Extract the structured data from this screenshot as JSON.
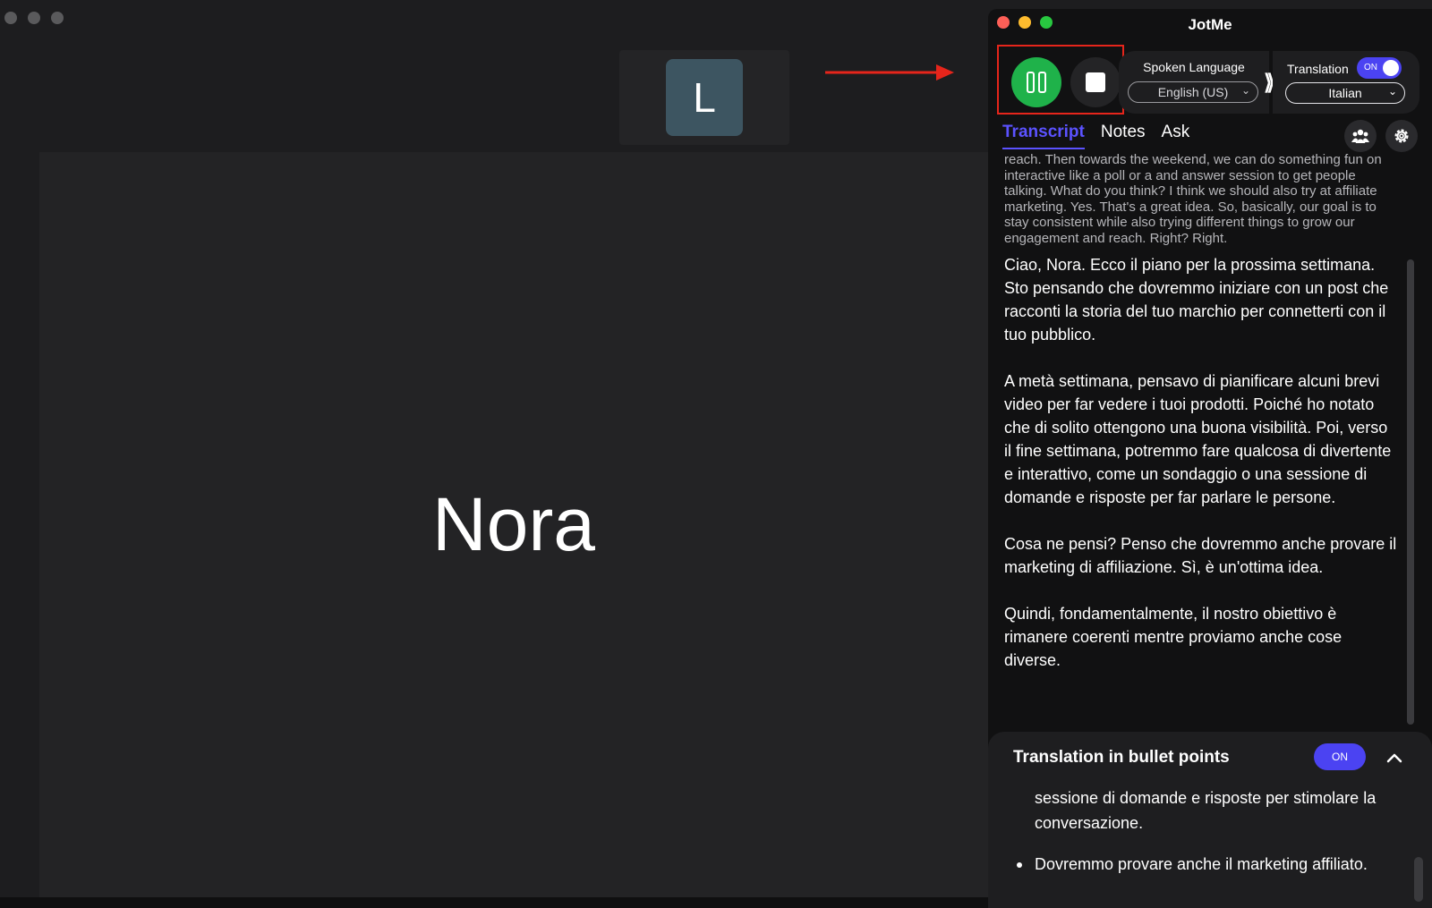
{
  "meeting": {
    "avatar_letter": "L",
    "speaker_name": "Nora"
  },
  "jotme": {
    "title": "JotMe",
    "spoken_language_label": "Spoken Language",
    "spoken_language_value": "English (US)",
    "translation_label": "Translation",
    "translation_toggle": "ON",
    "translation_language": "Italian",
    "tabs": [
      {
        "label": "Transcript",
        "active": true
      },
      {
        "label": "Notes",
        "active": false
      },
      {
        "label": "Ask",
        "active": false
      }
    ],
    "original_text": "reach. Then towards the weekend, we can do something fun on interactive like a poll or a and answer session to get people talking. What do you think? I think we should also try at affiliate marketing. Yes. That's a great idea. So, basically, our goal is to stay consistent while also trying different things to grow our engagement and reach. Right? Right.",
    "translated_paragraphs": [
      "Ciao, Nora. Ecco il piano per la prossima settimana. Sto pensando che dovremmo iniziare con un post che racconti la storia del tuo marchio per connetterti con il tuo pubblico.",
      "A metà settimana, pensavo di pianificare alcuni brevi video per far vedere i tuoi prodotti. Poiché ho notato che di solito ottengono una buona visibilità. Poi, verso il fine settimana, potremmo fare qualcosa di divertente e interattivo, come un sondaggio o una sessione di domande e risposte per far parlare le persone.",
      "Cosa ne pensi? Penso che dovremmo anche provare il marketing di affiliazione. Sì, è un'ottima idea.",
      "Quindi, fondamentalmente, il nostro obiettivo è rimanere coerenti mentre proviamo anche cose diverse."
    ],
    "bullets_title": "Translation in bullet points",
    "bullets_toggle": "ON",
    "bullet_continuation": "sessione di domande e risposte per stimolare la conversazione.",
    "bullet_item": "Dovremmo provare anche il marketing affiliato."
  },
  "colors": {
    "accent": "#4b43f2",
    "record_green": "#1fb24a",
    "highlight_red": "#e6251b"
  },
  "icons": [
    "pause-icon",
    "stop-icon",
    "double-chevron-right-icon",
    "people-icon",
    "gear-icon",
    "chevron-up-icon",
    "chevron-down-icon",
    "red-arrow-icon"
  ]
}
